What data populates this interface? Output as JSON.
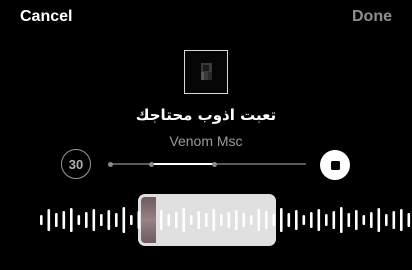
{
  "topbar": {
    "cancel_label": "Cancel",
    "done_label": "Done"
  },
  "track": {
    "title": "تعبت اذوب محتاجك",
    "artist": "Venom Msc",
    "artwork_icon": "album-art-icon"
  },
  "controls": {
    "skip_back_label": "30",
    "skip_back_icon": "skip-back-30-icon",
    "stop_icon": "stop-icon"
  },
  "colors": {
    "background": "#000000",
    "text_primary": "#ffffff",
    "text_secondary": "#8e8e93",
    "selection": "#ffffff"
  }
}
